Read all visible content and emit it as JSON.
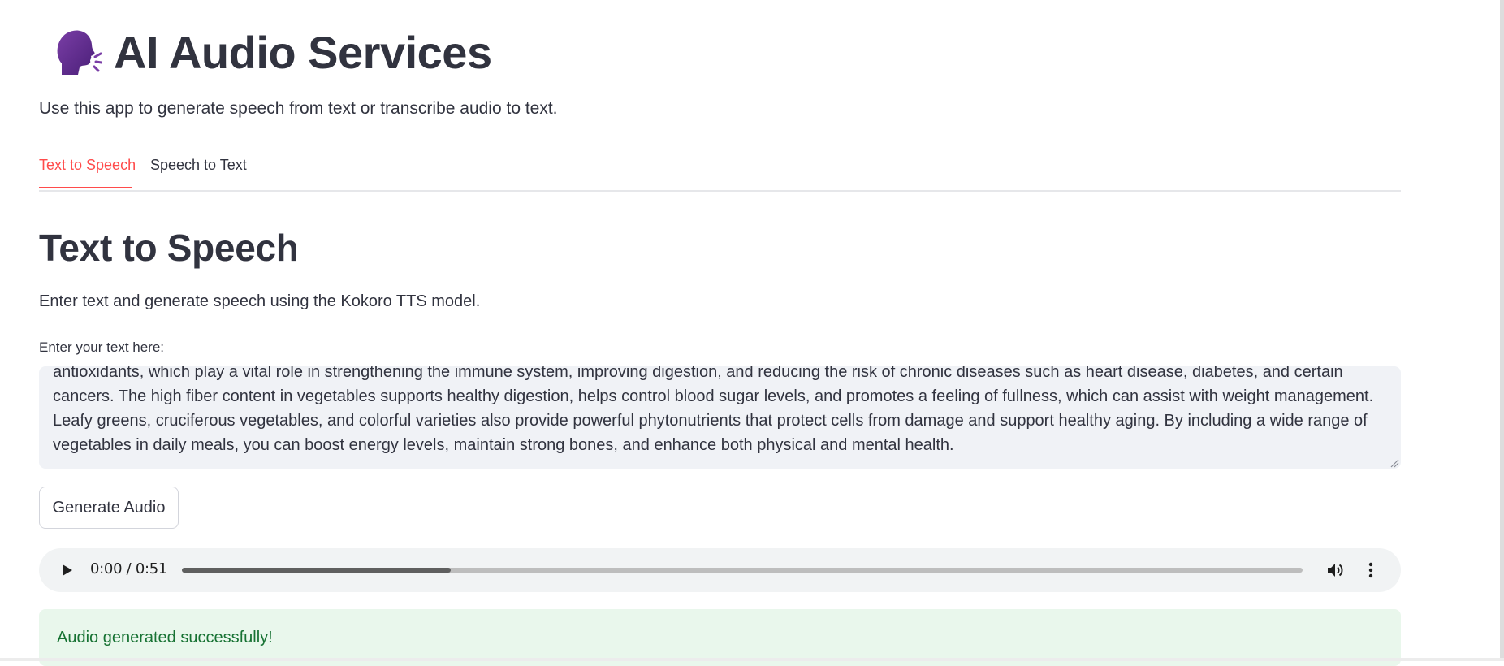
{
  "header": {
    "icon": "speaking-head-icon",
    "title": "AI Audio Services",
    "intro": "Use this app to generate speech from text or transcribe audio to text."
  },
  "tabs": [
    {
      "label": "Text to Speech",
      "active": true
    },
    {
      "label": "Speech to Text",
      "active": false
    }
  ],
  "section": {
    "title": "Text to Speech",
    "description": "Enter text and generate speech using the Kokoro TTS model."
  },
  "text_input": {
    "label": "Enter your text here:",
    "value": "antioxidants, which play a vital role in strengthening the immune system, improving digestion, and reducing the risk of chronic diseases such as heart disease, diabetes, and certain cancers. The high fiber content in vegetables supports healthy digestion, helps control blood sugar levels, and promotes a feeling of fullness, which can assist with weight management. Leafy greens, cruciferous vegetables, and colorful varieties also provide powerful phytonutrients that protect cells from damage and support healthy aging. By including a wide range of vegetables in daily meals, you can boost energy levels, maintain strong bones, and enhance both physical and mental health."
  },
  "generate_button": {
    "label": "Generate Audio"
  },
  "audio_player": {
    "time": "0:00 / 0:51",
    "buffered_fraction": 0.24
  },
  "status": {
    "message": "Audio generated successfully!"
  },
  "colors": {
    "accent": "#ff4b4b",
    "text": "#31333f",
    "input_bg": "#f0f2f6",
    "success_bg": "#e9f7ec",
    "success_text": "#177233"
  }
}
